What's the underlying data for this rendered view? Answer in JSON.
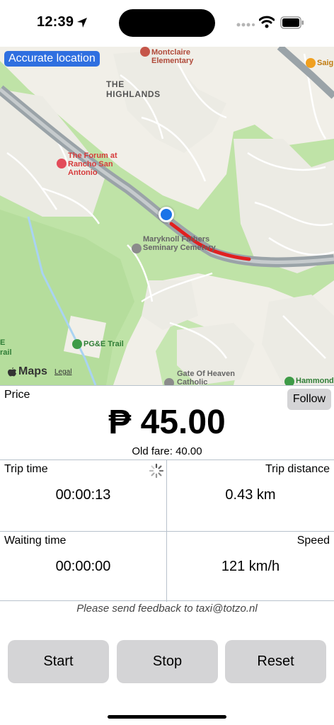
{
  "status_bar": {
    "time": "12:39",
    "icons": [
      "location-arrow-icon",
      "cellular-dots-icon",
      "wifi-icon",
      "battery-icon"
    ]
  },
  "map": {
    "accuracy_badge": "Accurate location",
    "labels": {
      "elementary": "Montclaire Elementary",
      "highlands": "THE HIGHLANDS",
      "forum": "The Forum at Rancho San Antonio",
      "maryknoll": "Maryknoll Fathers Seminary Cemetery",
      "pge_trail": "PG&E Trail",
      "gate_heaven": "Gate Of Heaven Catholic",
      "hammond": "Hammond",
      "saig": "Saig",
      "edge_e": "E",
      "edge_rail": "rail"
    },
    "attribution": "Maps",
    "legal": "Legal",
    "colors": {
      "land": "#f1efe8",
      "park": "#bfe3a7",
      "highway": "#9aa3a8",
      "route": "#e02020",
      "user_dot": "#1a73e8",
      "water": "#a9d3f2"
    }
  },
  "price": {
    "label": "Price",
    "value": "₱ 45.00",
    "old_fare_label": "Old fare:",
    "old_fare_value": "40.00",
    "follow_label": "Follow"
  },
  "stats": {
    "trip_time": {
      "label": "Trip time",
      "value": "00:00:13"
    },
    "trip_distance": {
      "label": "Trip distance",
      "value": "0.43 km"
    },
    "waiting_time": {
      "label": "Waiting time",
      "value": "00:00:00"
    },
    "speed": {
      "label": "Speed",
      "value": "121 km/h"
    }
  },
  "feedback_text": "Please send feedback to taxi@totzo.nl",
  "controls": {
    "start": "Start",
    "stop": "Stop",
    "reset": "Reset"
  }
}
